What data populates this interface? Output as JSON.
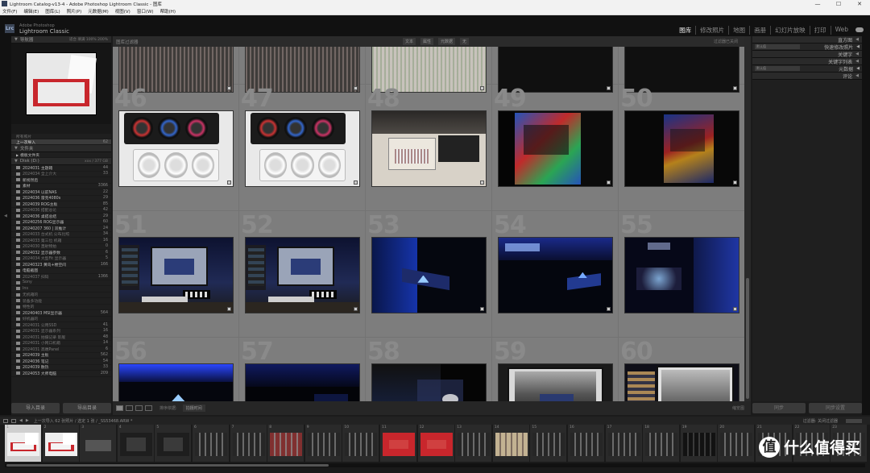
{
  "window": {
    "title": "Lightroom Catalog-v13-4 - Adobe Photoshop Lightroom Classic - 图库",
    "controls": [
      "—",
      "☐",
      "✕"
    ]
  },
  "menu": [
    "文件(F)",
    "编辑(E)",
    "图库(L)",
    "照片(P)",
    "元数据(M)",
    "视图(V)",
    "窗口(W)",
    "帮助(H)"
  ],
  "brand": {
    "logo": "Lrc",
    "line1": "Adobe Photoshop",
    "line2": "Lightroom Classic"
  },
  "modules": [
    {
      "label": "图库",
      "active": true
    },
    {
      "label": "修改照片",
      "active": false
    },
    {
      "label": "地图",
      "active": false
    },
    {
      "label": "画册",
      "active": false
    },
    {
      "label": "幻灯片放映",
      "active": false
    },
    {
      "label": "打印",
      "active": false
    },
    {
      "label": "Web",
      "active": false
    }
  ],
  "left_panel": {
    "navigator": {
      "title": "导航器",
      "zoom": "适合  填满  100%  200%"
    },
    "catalog": [
      {
        "label": "所有照片",
        "count": "",
        "state": "dim"
      },
      {
        "label": "上一次导入",
        "count": "62",
        "state": "hl"
      }
    ],
    "folders_title": "文件夹",
    "collections_title": "模板文件夹",
    "volume": {
      "label": "Disk (D:)",
      "info": "xxx / 377 GB"
    },
    "folders": [
      {
        "label": "2024031 主题箱",
        "count": "44",
        "state": "bright"
      },
      {
        "label": "2024034 全上介大",
        "count": "33",
        "state": "dim"
      },
      {
        "label": "新视然后",
        "count": "",
        "state": "bright"
      },
      {
        "label": "素材",
        "count": "3366",
        "state": "bright"
      },
      {
        "label": "2024034 以前NAS",
        "count": "22",
        "state": "bright"
      },
      {
        "label": "2024036 雷克4080s",
        "count": "29",
        "state": "bright"
      },
      {
        "label": "2024039 ROG主板",
        "count": "85",
        "state": "bright"
      },
      {
        "label": "2024036 搭配总论",
        "count": "42",
        "state": "dim"
      },
      {
        "label": "2024036 桌搭总结",
        "count": "29",
        "state": "bright"
      },
      {
        "label": "20240256 ROG显示器",
        "count": "60",
        "state": "bright"
      },
      {
        "label": "20240207 360 | 双推计",
        "count": "24",
        "state": "bright"
      },
      {
        "label": "2024033 台式机 公布比照",
        "count": "34",
        "state": "dim"
      },
      {
        "label": "2024033 第三位 机箱",
        "count": "16",
        "state": "dim"
      },
      {
        "label": "2024030 直射物拍",
        "count": "0",
        "state": "dim"
      },
      {
        "label": "2024032 显示器参数",
        "count": "6",
        "state": "bright"
      },
      {
        "label": "2024034 大型Fit 显示器",
        "count": "5",
        "state": "dim"
      },
      {
        "label": "20240323 黄鸟+楼空间",
        "count": "166",
        "state": "bright"
      },
      {
        "label": "电脑截图",
        "count": "",
        "state": "bright"
      },
      {
        "label": "2024037 扫码",
        "count": "1366",
        "state": "dim"
      },
      {
        "label": "Sony",
        "count": "",
        "state": "dim"
      },
      {
        "label": "Ins",
        "count": "",
        "state": "dim"
      },
      {
        "label": "无机箱的",
        "count": "",
        "state": "dim"
      },
      {
        "label": "装备多功能",
        "count": "",
        "state": "dim"
      },
      {
        "label": "特性的",
        "count": "",
        "state": "dim"
      },
      {
        "label": "20240403 MSI显示器",
        "count": "564",
        "state": "bright"
      },
      {
        "label": "好机器的",
        "count": "",
        "state": "dim"
      },
      {
        "label": "2024031 公用SSD",
        "count": "41",
        "state": "dim"
      },
      {
        "label": "2024031 显示器系列",
        "count": "16",
        "state": "dim"
      },
      {
        "label": "2024031 拍摄记录 影舰",
        "count": "48",
        "state": "dim"
      },
      {
        "label": "2024031 小网口机箱",
        "count": "14",
        "state": "dim"
      },
      {
        "label": "2024031 高端Panel",
        "count": "6",
        "state": "dim"
      },
      {
        "label": "2024039 主板",
        "count": "562",
        "state": "bright"
      },
      {
        "label": "2024036 笔记",
        "count": "54",
        "state": "bright"
      },
      {
        "label": "2024039 散热",
        "count": "33",
        "state": "bright"
      },
      {
        "label": "2024053 大师电脑",
        "count": "209",
        "state": "bright"
      }
    ],
    "buttons": [
      "导入目录",
      "导出目录"
    ]
  },
  "filter_bar": {
    "label": "图库过滤器",
    "tabs": [
      "文本",
      "属性",
      "元数据",
      "无"
    ],
    "right": "过滤器已关闭"
  },
  "grid": [
    {
      "num": "",
      "thumb": "top-1"
    },
    {
      "num": "",
      "thumb": "top-2"
    },
    {
      "num": "",
      "thumb": "top-3"
    },
    {
      "num": "",
      "thumb": "top-4"
    },
    {
      "num": "",
      "thumb": "top-5"
    },
    {
      "num": "46",
      "thumb": "gpu-black"
    },
    {
      "num": "47",
      "thumb": "gpu-black"
    },
    {
      "num": "48",
      "thumb": "psu"
    },
    {
      "num": "49",
      "thumb": "case-rgb"
    },
    {
      "num": "50",
      "thumb": "case-rgb-dark"
    },
    {
      "num": "51",
      "thumb": "desk"
    },
    {
      "num": "52",
      "thumb": "desk"
    },
    {
      "num": "53",
      "thumb": "case-blue"
    },
    {
      "num": "54",
      "thumb": "case-blue2"
    },
    {
      "num": "55",
      "thumb": "case-blue3"
    },
    {
      "num": "56",
      "thumb": "blue-light"
    },
    {
      "num": "57",
      "thumb": "blue-dark"
    },
    {
      "num": "58",
      "thumb": "case-glow"
    },
    {
      "num": "59",
      "thumb": "monitor-white"
    },
    {
      "num": "60",
      "thumb": "monitor-dual"
    }
  ],
  "toolbar": {
    "sort_label": "排序依据:",
    "sort_value": "拍摄时间",
    "zoom_label": "缩览图"
  },
  "right_panel": {
    "histogram": "直方图",
    "quick_develop": {
      "preset": "默认值",
      "label": "快速修改照片"
    },
    "keywords": "关键字",
    "keyword_list": "关键字列表",
    "metadata": {
      "preset": "默认值",
      "label": "元数据"
    },
    "comments": "评论",
    "buttons": [
      "同步",
      "同步设置"
    ]
  },
  "filmstrip": {
    "info": "上一次导入   62 张照片 / 选定 1 张 / _SS53468.ARW *",
    "filter": "过滤器:",
    "filter_value": "关闭过滤器",
    "frames": [
      {
        "num": "1",
        "kind": "keyboard-white",
        "selected": true
      },
      {
        "num": "2",
        "kind": "keyboard-white",
        "selected": false
      },
      {
        "num": "3",
        "kind": "keyboard-dark",
        "selected": false
      },
      {
        "num": "4",
        "kind": "dark-device",
        "selected": false
      },
      {
        "num": "5",
        "kind": "dark-device",
        "selected": false
      },
      {
        "num": "6",
        "kind": "keys",
        "selected": false
      },
      {
        "num": "7",
        "kind": "keys",
        "selected": false
      },
      {
        "num": "8",
        "kind": "keys-red",
        "selected": false
      },
      {
        "num": "9",
        "kind": "keys",
        "selected": false
      },
      {
        "num": "10",
        "kind": "keys",
        "selected": false
      },
      {
        "num": "11",
        "kind": "red",
        "selected": false
      },
      {
        "num": "12",
        "kind": "red",
        "selected": false
      },
      {
        "num": "13",
        "kind": "keys",
        "selected": false
      },
      {
        "num": "14",
        "kind": "keys-tan",
        "selected": false
      },
      {
        "num": "15",
        "kind": "keys",
        "selected": false
      },
      {
        "num": "16",
        "kind": "keys",
        "selected": false
      },
      {
        "num": "17",
        "kind": "keys",
        "selected": false
      },
      {
        "num": "18",
        "kind": "keys",
        "selected": false
      },
      {
        "num": "19",
        "kind": "keys-dark",
        "selected": false
      },
      {
        "num": "20",
        "kind": "keys",
        "selected": false
      },
      {
        "num": "21",
        "kind": "keys",
        "selected": false
      },
      {
        "num": "22",
        "kind": "keys",
        "selected": false
      },
      {
        "num": "23",
        "kind": "keys",
        "selected": false
      }
    ]
  },
  "watermark": {
    "glyph": "值",
    "text": "什么值得买"
  }
}
